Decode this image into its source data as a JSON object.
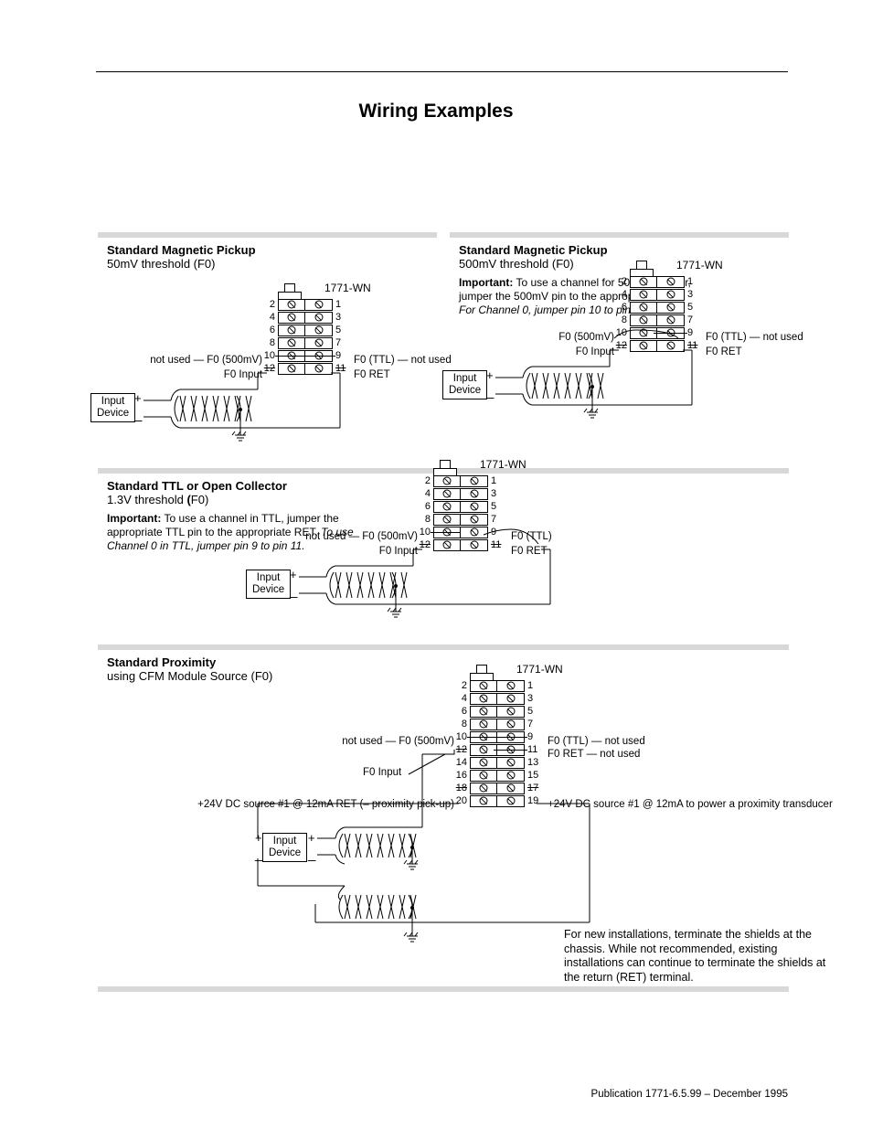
{
  "title": "Wiring Examples",
  "publication": "Publication 1771-6.5.99 – December 1995",
  "connector_label": "1771-WN",
  "input_device_label": "Input\nDevice",
  "note_shields": "For new installations, terminate the shields at the chassis.  While not recommended, existing installations can continue to terminate the shields at the return (RET) terminal.",
  "sections": {
    "magpick50": {
      "title": "Standard Magnetic Pickup",
      "sub": "50mV threshold (F0)",
      "left_labels": {
        "pin10": "not used — F0 (500mV)",
        "pin12": "F0 Input"
      },
      "right_labels": {
        "pin9": "F0 (TTL) — not used",
        "pin11": "F0 RET"
      },
      "pin_numbers_left": [
        "2",
        "4",
        "6",
        "8",
        "10",
        "12"
      ],
      "pin_numbers_right": [
        "1",
        "3",
        "5",
        "7",
        "9",
        "11"
      ]
    },
    "magpick500": {
      "title": "Standard Magnetic Pickup",
      "sub": "500mV threshold (F0)",
      "important_bold": "Important:",
      "important_text": " To use a channel for 500mV sensor, jumper the 500mV pin to the appropriate RET.  ",
      "important_italic": "For Channel 0, jumper pin 10 to pin 11.",
      "left_labels": {
        "pin10": "F0 (500mV)",
        "pin12": "F0 Input"
      },
      "right_labels": {
        "pin9": "F0 (TTL) — not used",
        "pin11": "F0 RET"
      },
      "pin_numbers_left": [
        "2",
        "4",
        "6",
        "8",
        "10",
        "12"
      ],
      "pin_numbers_right": [
        "1",
        "3",
        "5",
        "7",
        "9",
        "11"
      ]
    },
    "ttl": {
      "title": "Standard TTL or Open Collector",
      "sub": "1.3V threshold (F0)",
      "important_bold": "Important:",
      "important_text": " To use a channel in TTL, jumper the appropriate TTL pin to the appropriate RET. ",
      "important_italic": "To use Channel 0 in TTL, jumper pin 9 to pin 11.",
      "left_labels": {
        "pin10": "not used — F0 (500mV)",
        "pin12": "F0 Input"
      },
      "right_labels": {
        "pin9": "F0 (TTL)",
        "pin11": "F0 RET"
      },
      "pin_numbers_left": [
        "2",
        "4",
        "6",
        "8",
        "10",
        "12"
      ],
      "pin_numbers_right": [
        "1",
        "3",
        "5",
        "7",
        "9",
        "11"
      ]
    },
    "prox": {
      "title": "Standard Proximity",
      "sub": "using CFM Module Source (F0)",
      "left_labels": {
        "pin10": "not used — F0 (500mV)",
        "pin12_arrow": "F0 Input",
        "pin18": "+24V DC source #1 @ 12mA RET (– proximity pick-up)"
      },
      "right_labels": {
        "pin9": "F0 (TTL) — not used",
        "pin11": "F0 RET — not used",
        "pin17": "+24V DC source #1 @ 12mA to power a proximity transducer"
      },
      "pin_numbers_left": [
        "2",
        "4",
        "6",
        "8",
        "10",
        "12",
        "14",
        "16",
        "18",
        "20"
      ],
      "pin_numbers_right": [
        "1",
        "3",
        "5",
        "7",
        "9",
        "11",
        "13",
        "15",
        "17",
        "19"
      ]
    }
  }
}
